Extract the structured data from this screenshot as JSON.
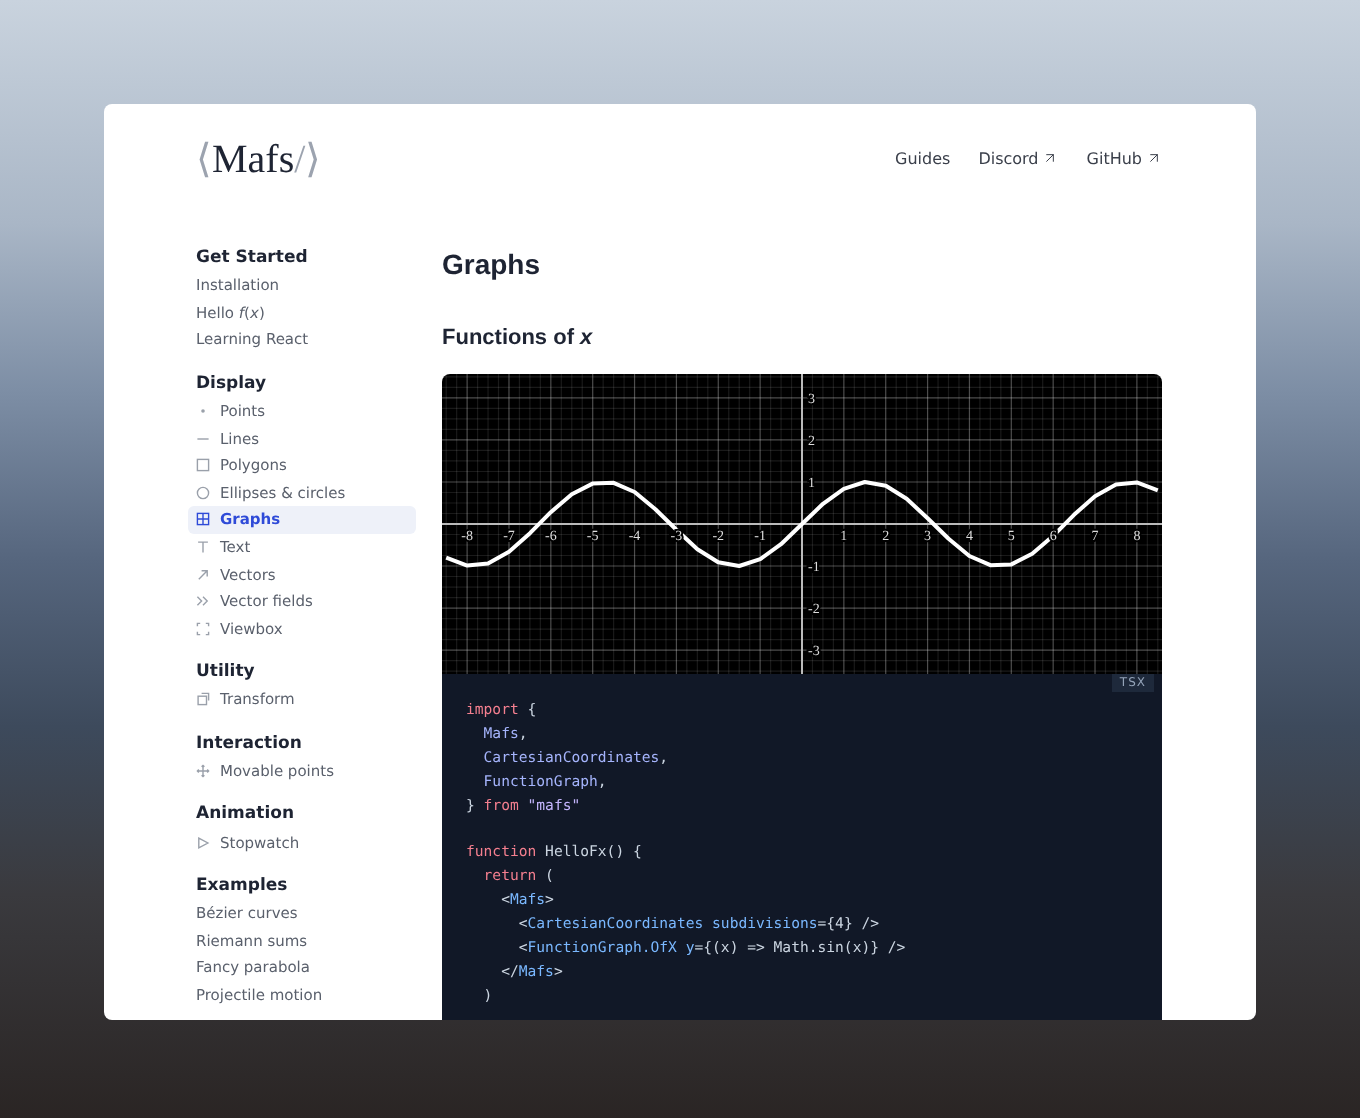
{
  "logo": {
    "open": "⟨",
    "name": "Mafs",
    "close": "/⟩"
  },
  "nav": [
    {
      "label": "Guides",
      "external": false
    },
    {
      "label": "Discord",
      "external": true
    },
    {
      "label": "GitHub",
      "external": true
    }
  ],
  "sidebar": {
    "sections": [
      {
        "title": "Get Started",
        "items": [
          {
            "label": "Installation",
            "kind": "plain",
            "selected": false
          },
          {
            "label": "Hello *f*(*x*)",
            "kind": "plain",
            "selected": false
          },
          {
            "label": "Learning React",
            "kind": "plain",
            "selected": false
          }
        ]
      },
      {
        "title": "Display",
        "items": [
          {
            "label": "Points",
            "kind": "dot",
            "selected": false
          },
          {
            "label": "Lines",
            "kind": "line",
            "selected": false
          },
          {
            "label": "Polygons",
            "kind": "square",
            "selected": false
          },
          {
            "label": "Ellipses & circles",
            "kind": "circle",
            "selected": false
          },
          {
            "label": "Graphs",
            "kind": "grid",
            "selected": true
          },
          {
            "label": "Text",
            "kind": "text",
            "selected": false
          },
          {
            "label": "Vectors",
            "kind": "arrow",
            "selected": false
          },
          {
            "label": "Vector fields",
            "kind": "chevrons",
            "selected": false
          },
          {
            "label": "Viewbox",
            "kind": "frame",
            "selected": false
          }
        ]
      },
      {
        "title": "Utility",
        "items": [
          {
            "label": "Transform",
            "kind": "box",
            "selected": false
          }
        ]
      },
      {
        "title": "Interaction",
        "items": [
          {
            "label": "Movable points",
            "kind": "move",
            "selected": false
          }
        ]
      },
      {
        "title": "Animation",
        "items": [
          {
            "label": "Stopwatch",
            "kind": "play",
            "selected": false
          }
        ]
      },
      {
        "title": "Examples",
        "items": [
          {
            "label": "Bézier curves",
            "kind": "plain",
            "selected": false
          },
          {
            "label": "Riemann sums",
            "kind": "plain",
            "selected": false
          },
          {
            "label": "Fancy parabola",
            "kind": "plain",
            "selected": false
          },
          {
            "label": "Projectile motion",
            "kind": "plain",
            "selected": false
          }
        ]
      }
    ]
  },
  "main": {
    "title": "Graphs",
    "subtitle": "Functions of *x*",
    "chart_data": {
      "type": "line",
      "grid": true,
      "xlim": [
        -8.6,
        8.6
      ],
      "ylim": [
        -3.57,
        3.57
      ],
      "xticks": [
        -8,
        -7,
        -6,
        -5,
        -4,
        -3,
        -2,
        -1,
        1,
        2,
        3,
        4,
        5,
        6,
        7,
        8
      ],
      "yticks": [
        -3,
        -2,
        -1,
        1,
        2,
        3
      ],
      "x": [
        -8.5,
        -8,
        -7.5,
        -7,
        -6.5,
        -6,
        -5.5,
        -5,
        -4.5,
        -4,
        -3.5,
        -3,
        -2.5,
        -2,
        -1.5,
        -1,
        -0.5,
        0,
        0.5,
        1,
        1.5,
        2,
        2.5,
        3,
        3.5,
        4,
        4.5,
        5,
        5.5,
        6,
        6.5,
        7,
        7.5,
        8,
        8.5
      ],
      "series": [
        {
          "color": "#ffffff",
          "values": [
            -0.8,
            -0.99,
            -0.94,
            -0.66,
            -0.22,
            0.28,
            0.71,
            0.96,
            0.98,
            0.76,
            0.35,
            -0.14,
            -0.6,
            -0.91,
            -1.0,
            -0.84,
            -0.48,
            0,
            0.48,
            0.84,
            1.0,
            0.91,
            0.6,
            0.14,
            -0.35,
            -0.76,
            -0.98,
            -0.96,
            -0.71,
            -0.28,
            0.22,
            0.66,
            0.94,
            0.99,
            0.8
          ]
        }
      ]
    },
    "code": {
      "language": "TSX",
      "lines": [
        {
          "blank_before": false,
          "tokens": [
            {
              "kind": "keyword",
              "text": "import"
            },
            {
              "kind": "plain",
              "text": " {"
            }
          ]
        },
        {
          "blank_before": false,
          "tokens": [
            {
              "kind": "name",
              "text": "  Mafs"
            },
            {
              "kind": "plain",
              "text": ","
            }
          ]
        },
        {
          "blank_before": false,
          "tokens": [
            {
              "kind": "name",
              "text": "  CartesianCoordinates"
            },
            {
              "kind": "plain",
              "text": ","
            }
          ]
        },
        {
          "blank_before": false,
          "tokens": [
            {
              "kind": "name",
              "text": "  FunctionGraph"
            },
            {
              "kind": "plain",
              "text": ","
            }
          ]
        },
        {
          "blank_before": false,
          "tokens": [
            {
              "kind": "plain",
              "text": "} "
            },
            {
              "kind": "keyword",
              "text": "from"
            },
            {
              "kind": "string",
              "text": " \"mafs\""
            }
          ]
        },
        {
          "blank_before": true,
          "tokens": [
            {
              "kind": "keyword",
              "text": "function"
            },
            {
              "kind": "plain",
              "text": " HelloFx() {"
            }
          ]
        },
        {
          "blank_before": false,
          "tokens": [
            {
              "kind": "keyword",
              "text": "  return"
            },
            {
              "kind": "plain",
              "text": " ("
            }
          ]
        },
        {
          "blank_before": false,
          "tokens": [
            {
              "kind": "plain",
              "text": "    <"
            },
            {
              "kind": "tag",
              "text": "Mafs"
            },
            {
              "kind": "plain",
              "text": ">"
            }
          ]
        },
        {
          "blank_before": false,
          "tokens": [
            {
              "kind": "plain",
              "text": "      <"
            },
            {
              "kind": "tag",
              "text": "CartesianCoordinates"
            },
            {
              "kind": "tag",
              "text": " subdivisions"
            },
            {
              "kind": "plain",
              "text": "={4} />"
            }
          ]
        },
        {
          "blank_before": false,
          "tokens": [
            {
              "kind": "plain",
              "text": "      <"
            },
            {
              "kind": "tag",
              "text": "FunctionGraph.OfX"
            },
            {
              "kind": "tag",
              "text": " y"
            },
            {
              "kind": "plain",
              "text": "={(x) => Math.sin(x)} />"
            }
          ]
        },
        {
          "blank_before": false,
          "tokens": [
            {
              "kind": "plain",
              "text": "    </"
            },
            {
              "kind": "tag",
              "text": "Mafs"
            },
            {
              "kind": "plain",
              "text": ">"
            }
          ]
        },
        {
          "blank_before": false,
          "tokens": [
            {
              "kind": "plain",
              "text": "  )"
            }
          ]
        }
      ]
    }
  }
}
